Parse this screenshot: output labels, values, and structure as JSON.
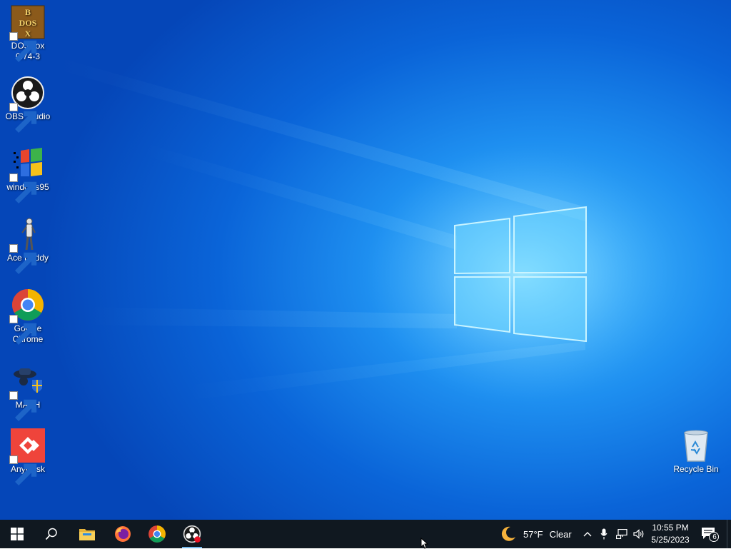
{
  "desktop": {
    "icons": [
      {
        "label": "DOSBox 0.74-3",
        "icon": "dosbox-icon"
      },
      {
        "label": "OBS Studio",
        "icon": "obs-icon"
      },
      {
        "label": "windows95",
        "icon": "windows95-icon"
      },
      {
        "label": "Ace Buddy",
        "icon": "ace-buddy-icon"
      },
      {
        "label": "Google Chrome",
        "icon": "chrome-icon"
      },
      {
        "label": "MASH",
        "icon": "mash-icon"
      },
      {
        "label": "AnyDesk",
        "icon": "anydesk-icon"
      }
    ],
    "recycle_bin": {
      "label": "Recycle Bin",
      "icon": "recycle-bin-icon"
    }
  },
  "taskbar": {
    "pinned": [
      {
        "name": "start",
        "icon": "windows-logo-icon"
      },
      {
        "name": "search",
        "icon": "search-icon"
      },
      {
        "name": "file-explorer",
        "icon": "folder-icon"
      },
      {
        "name": "firefox",
        "icon": "firefox-icon"
      },
      {
        "name": "chrome",
        "icon": "chrome-icon"
      },
      {
        "name": "obs",
        "icon": "obs-icon",
        "active": true
      }
    ],
    "weather": {
      "temperature": "57°F",
      "condition": "Clear",
      "icon": "moon-icon"
    },
    "tray_icons": [
      "chevron-up-icon",
      "microphone-icon",
      "network-icon",
      "speaker-icon"
    ],
    "clock": {
      "time": "10:55 PM",
      "date": "5/25/2023"
    },
    "notifications": {
      "count": "6",
      "icon": "action-center-icon"
    }
  },
  "colors": {
    "desktop_dark": "#0546b8",
    "desktop_light": "#4fc3ff",
    "taskbar": "#101820",
    "accent": "#76b9ed"
  }
}
